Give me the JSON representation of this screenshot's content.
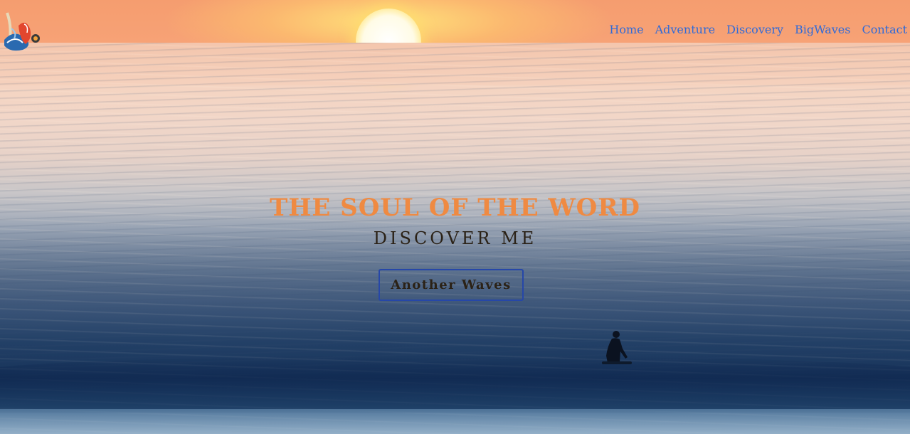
{
  "nav": {
    "items": [
      {
        "label": "Home"
      },
      {
        "label": "Adventure"
      },
      {
        "label": "Discovery"
      },
      {
        "label": "BigWaves"
      },
      {
        "label": "Contact"
      }
    ]
  },
  "hero": {
    "title": "THE SOUL OF THE WORD",
    "subtitle": "DISCOVER ME",
    "button_label": "Another Waves"
  },
  "colors": {
    "title": "#ef8a42",
    "nav_link": "#2f6ad8",
    "button_border": "#2647a8",
    "text_dark": "#2b2217"
  },
  "icons": {
    "logo": "surf-logo-icon"
  }
}
